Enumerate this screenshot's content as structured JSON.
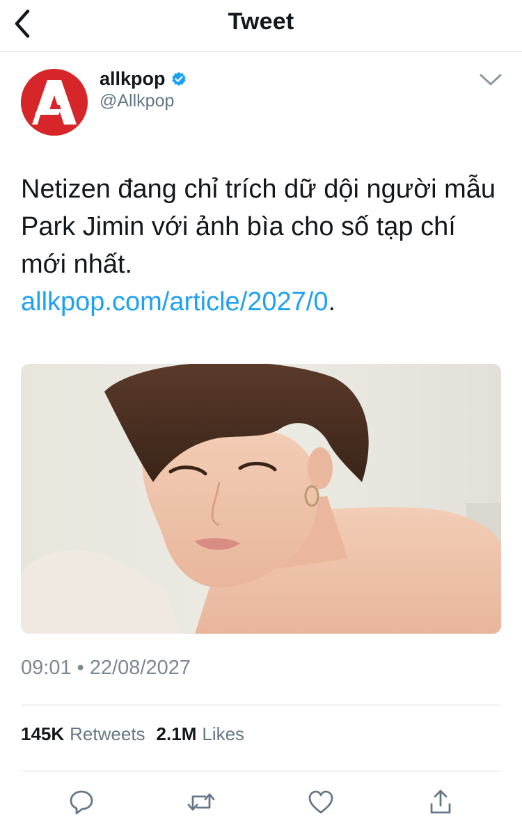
{
  "header": {
    "back_icon": "chevron-left-icon",
    "title": "Tweet"
  },
  "tweet": {
    "author": {
      "name": "allkpop",
      "handle": "@Allkpop",
      "verified": true,
      "avatar_color": "#d7262a"
    },
    "text": "Netizen đang chỉ trích dữ dội người mẫu Park Jimin với ảnh bìa cho số tạp chí mới nhất.",
    "link": "allkpop.com/article/2027/0",
    "link_suffix": ".",
    "time": "09:01",
    "separator": "•",
    "date": "22/08/2027"
  },
  "stats": {
    "retweets_count": "145K",
    "retweets_label": "Retweets",
    "likes_count": "2.1M",
    "likes_label": "Likes"
  },
  "actions": [
    "reply-icon",
    "retweet-icon",
    "like-icon",
    "share-icon"
  ],
  "colors": {
    "link": "#1da1f2",
    "secondary_text": "#657786",
    "verified": "#1da1f2"
  }
}
